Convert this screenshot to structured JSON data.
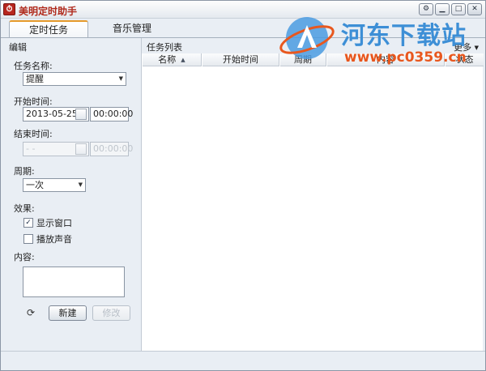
{
  "window": {
    "title": "美明定时助手"
  },
  "watermark": {
    "name": "河东下载站",
    "url": "www.pc0359.cn"
  },
  "tabs": [
    {
      "label": "定时任务",
      "active": true
    },
    {
      "label": "音乐管理",
      "active": false
    }
  ],
  "editor": {
    "title": "编辑",
    "task_name_label": "任务名称:",
    "task_name_value": "提醒",
    "start_time_label": "开始时间:",
    "start_date": "2013-05-25",
    "start_time": "00:00:00",
    "end_time_label": "结束时间:",
    "end_date": " -  - ",
    "end_time": "00:00:00",
    "period_label": "周期:",
    "period_value": "一次",
    "effect_label": "效果:",
    "show_window_label": "显示窗口",
    "show_window_checked": true,
    "play_sound_label": "播放声音",
    "play_sound_checked": false,
    "content_label": "内容:",
    "content_value": "",
    "new_button": "新建",
    "modify_button": "修改"
  },
  "task_list": {
    "title": "任务列表",
    "more_label": "更多",
    "columns": [
      "名称",
      "开始时间",
      "周期",
      "内容",
      "状态"
    ],
    "rows": []
  },
  "colors": {
    "title_red": "#b02a1c",
    "tab_accent": "#e59a2b",
    "watermark_blue": "#3d8fd6",
    "watermark_orange": "#e8571e"
  }
}
